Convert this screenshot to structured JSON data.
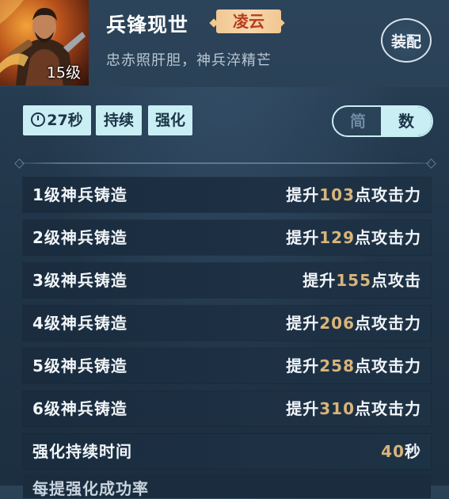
{
  "header": {
    "level_text": "15级",
    "title": "兵锋现世",
    "rank": "凌云",
    "description": "忠赤照肝胆，神兵淬精芒",
    "equip_label": "装配"
  },
  "tags": {
    "time": "27秒",
    "duration": "持续",
    "strength": "强化"
  },
  "toggle": {
    "simple": "简",
    "number": "数",
    "active": "数"
  },
  "rows": [
    {
      "label": "1级神兵铸造",
      "prefix": "提升",
      "value": "103",
      "suffix": "点攻击力"
    },
    {
      "label": "2级神兵铸造",
      "prefix": "提升",
      "value": "129",
      "suffix": "点攻击力"
    },
    {
      "label": "3级神兵铸造",
      "prefix": "提升",
      "value": "155",
      "suffix": "点攻击"
    },
    {
      "label": "4级神兵铸造",
      "prefix": "提升",
      "value": "206",
      "suffix": "点攻击力"
    },
    {
      "label": "5级神兵铸造",
      "prefix": "提升",
      "value": "258",
      "suffix": "点攻击力"
    },
    {
      "label": "6级神兵铸造",
      "prefix": "提升",
      "value": "310",
      "suffix": "点攻击力"
    },
    {
      "label": "强化持续时间",
      "prefix": "",
      "value": "40",
      "suffix": "秒"
    }
  ],
  "partial_row": {
    "label": "每提强化成功率"
  },
  "colors": {
    "accent_value": "#d9b47a",
    "rank_text": "#b53d1c",
    "tag_bg": "#c9eef4"
  }
}
